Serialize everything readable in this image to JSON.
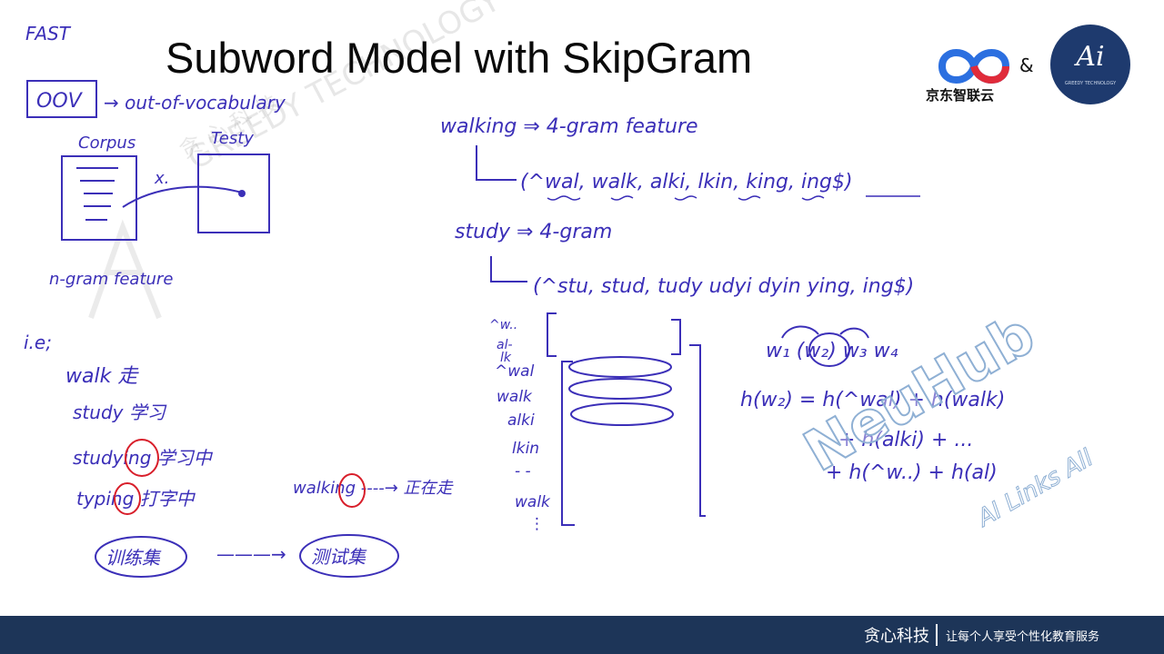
{
  "slide": {
    "title": "Subword Model with SkipGram",
    "ampersand": "&",
    "jd_logo_text": "京东智联云",
    "ai_logo_text": "Ai",
    "ai_logo_sub": "GREEDY TECHNOLOGY",
    "watermark_text": "GREEDY TECHNOLOGY",
    "watermark_cn": "贪 心 科 技",
    "neuhub_text": "NeuHub",
    "neuhub_sub": "AI Links All"
  },
  "footer": {
    "brand": "贪心科技",
    "slogan": "让每个人享受个性化教育服务"
  },
  "notes": {
    "fast": "FAST",
    "oov": "OOV",
    "oov_expansion": "→ out-of-vocabulary",
    "corpus": "Corpus",
    "test": "Testy",
    "x_mark": "x.",
    "ngram_feature": "n-gram feature",
    "ie": "i.e;",
    "walk": "walk 走",
    "study": "study 学习",
    "studying": "studying 学习中",
    "typing": "typing 打字中",
    "train_set": "训练集",
    "arrow_long": "———→",
    "test_set": "测试集",
    "walking_arrow": "walking ----→ 正在走",
    "walking_4gram": "walking ⇒ 4-gram feature",
    "walking_grams": "(^wal, walk, alki, lkin, king, ing$)",
    "study_4gram": "study ⇒ 4-gram",
    "study_grams": "(^stu, stud, tudy udyi dyin ying, ing$)",
    "stack_items": [
      "^w..",
      "al-",
      "lk",
      "^wal",
      "walk",
      "alki",
      "lkin",
      "- -",
      "walk",
      "⋮"
    ],
    "skip_words": "w₁ (w₂) w₃ w₄",
    "h_line1": "h(w₂) = h(^wal) + h(walk)",
    "h_line2": "+ h(alki) + ...",
    "h_line3": "+ h(^w..) + h(al)"
  }
}
